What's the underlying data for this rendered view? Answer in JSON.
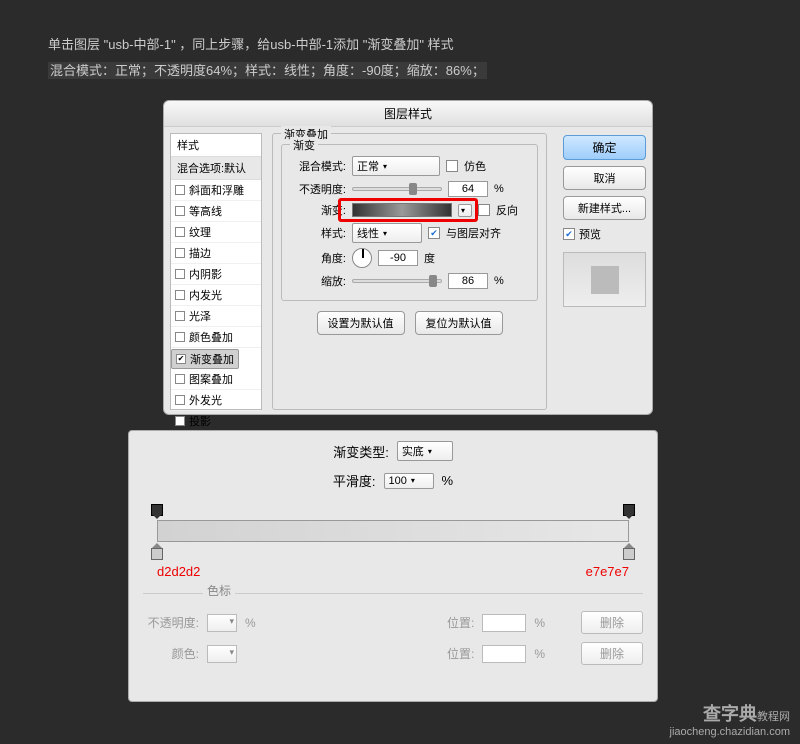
{
  "instructions": {
    "line1a": "单击图层 \"usb-中部-1\" ，同上步骤，给usb-中部-1添加",
    "line1b": "\"渐变叠加\"",
    "line1c": "样式",
    "line2": "混合模式：正常；不透明度64%；样式：线性；角度：-90度；缩放：86%；"
  },
  "dialog1": {
    "title": "图层样式",
    "sidebar": {
      "head": "样式",
      "blend": "混合选项:默认",
      "items": [
        {
          "label": "斜面和浮雕",
          "checked": false,
          "selected": false
        },
        {
          "label": "等高线",
          "checked": false,
          "selected": false
        },
        {
          "label": "纹理",
          "checked": false,
          "selected": false
        },
        {
          "label": "描边",
          "checked": false,
          "selected": false
        },
        {
          "label": "内阴影",
          "checked": false,
          "selected": false
        },
        {
          "label": "内发光",
          "checked": false,
          "selected": false
        },
        {
          "label": "光泽",
          "checked": false,
          "selected": false
        },
        {
          "label": "颜色叠加",
          "checked": false,
          "selected": false
        },
        {
          "label": "渐变叠加",
          "checked": true,
          "selected": true
        },
        {
          "label": "图案叠加",
          "checked": false,
          "selected": false
        },
        {
          "label": "外发光",
          "checked": false,
          "selected": false
        },
        {
          "label": "投影",
          "checked": false,
          "selected": false
        }
      ]
    },
    "panel": {
      "groupLabel": "渐变叠加",
      "innerLabel": "渐变",
      "blendMode": {
        "label": "混合模式:",
        "value": "正常",
        "dither": "仿色"
      },
      "opacity": {
        "label": "不透明度:",
        "value": "64",
        "unit": "%"
      },
      "gradient": {
        "label": "渐变:",
        "reverse": "反向"
      },
      "style": {
        "label": "样式:",
        "value": "线性",
        "align": "与图层对齐"
      },
      "angle": {
        "label": "角度:",
        "value": "-90",
        "unit": "度"
      },
      "scale": {
        "label": "缩放:",
        "value": "86",
        "unit": "%"
      },
      "defaultBtn": "设置为默认值",
      "resetBtn": "复位为默认值"
    },
    "buttons": {
      "ok": "确定",
      "cancel": "取消",
      "newStyle": "新建样式...",
      "preview": "预览"
    }
  },
  "dialog2": {
    "type": {
      "label": "渐变类型:",
      "value": "实底"
    },
    "smooth": {
      "label": "平滑度:",
      "value": "100",
      "unit": "%"
    },
    "leftColor": "d2d2d2",
    "rightColor": "e7e7e7",
    "stopsHead": "色标",
    "opacityRow": {
      "label": "不透明度:",
      "unit": "%",
      "posLabel": "位置:",
      "posUnit": "%",
      "delete": "删除"
    },
    "colorRow": {
      "label": "颜色:",
      "posLabel": "位置:",
      "posUnit": "%",
      "delete": "删除"
    }
  },
  "watermark": {
    "brand": "查字典",
    "sub": "教程网",
    "url": "jiaocheng.chazidian.com"
  }
}
